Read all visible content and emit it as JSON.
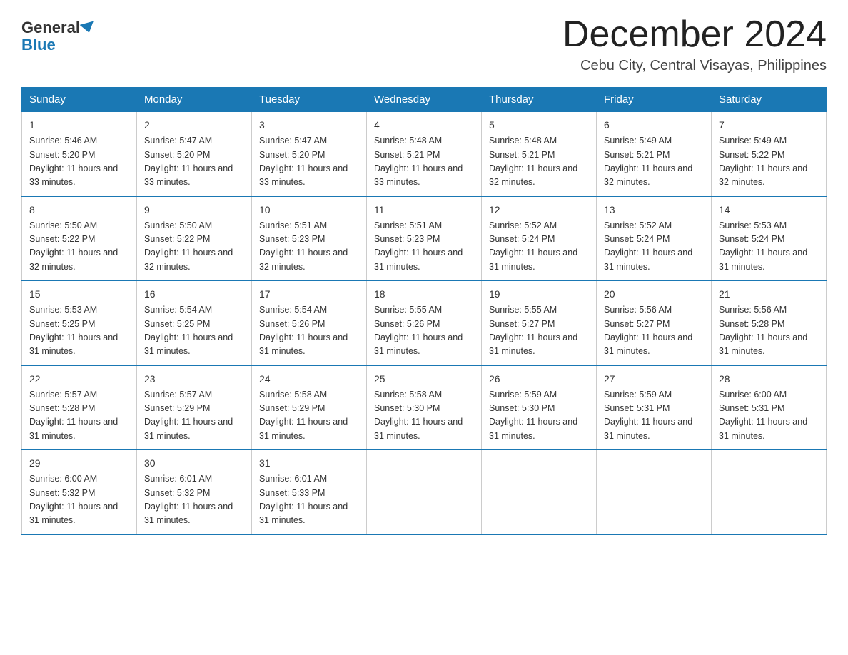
{
  "header": {
    "logo_general": "General",
    "logo_blue": "Blue",
    "month_title": "December 2024",
    "location": "Cebu City, Central Visayas, Philippines"
  },
  "weekdays": [
    "Sunday",
    "Monday",
    "Tuesday",
    "Wednesday",
    "Thursday",
    "Friday",
    "Saturday"
  ],
  "weeks": [
    [
      {
        "day": "1",
        "sunrise": "5:46 AM",
        "sunset": "5:20 PM",
        "daylight": "11 hours and 33 minutes."
      },
      {
        "day": "2",
        "sunrise": "5:47 AM",
        "sunset": "5:20 PM",
        "daylight": "11 hours and 33 minutes."
      },
      {
        "day": "3",
        "sunrise": "5:47 AM",
        "sunset": "5:20 PM",
        "daylight": "11 hours and 33 minutes."
      },
      {
        "day": "4",
        "sunrise": "5:48 AM",
        "sunset": "5:21 PM",
        "daylight": "11 hours and 33 minutes."
      },
      {
        "day": "5",
        "sunrise": "5:48 AM",
        "sunset": "5:21 PM",
        "daylight": "11 hours and 32 minutes."
      },
      {
        "day": "6",
        "sunrise": "5:49 AM",
        "sunset": "5:21 PM",
        "daylight": "11 hours and 32 minutes."
      },
      {
        "day": "7",
        "sunrise": "5:49 AM",
        "sunset": "5:22 PM",
        "daylight": "11 hours and 32 minutes."
      }
    ],
    [
      {
        "day": "8",
        "sunrise": "5:50 AM",
        "sunset": "5:22 PM",
        "daylight": "11 hours and 32 minutes."
      },
      {
        "day": "9",
        "sunrise": "5:50 AM",
        "sunset": "5:22 PM",
        "daylight": "11 hours and 32 minutes."
      },
      {
        "day": "10",
        "sunrise": "5:51 AM",
        "sunset": "5:23 PM",
        "daylight": "11 hours and 32 minutes."
      },
      {
        "day": "11",
        "sunrise": "5:51 AM",
        "sunset": "5:23 PM",
        "daylight": "11 hours and 31 minutes."
      },
      {
        "day": "12",
        "sunrise": "5:52 AM",
        "sunset": "5:24 PM",
        "daylight": "11 hours and 31 minutes."
      },
      {
        "day": "13",
        "sunrise": "5:52 AM",
        "sunset": "5:24 PM",
        "daylight": "11 hours and 31 minutes."
      },
      {
        "day": "14",
        "sunrise": "5:53 AM",
        "sunset": "5:24 PM",
        "daylight": "11 hours and 31 minutes."
      }
    ],
    [
      {
        "day": "15",
        "sunrise": "5:53 AM",
        "sunset": "5:25 PM",
        "daylight": "11 hours and 31 minutes."
      },
      {
        "day": "16",
        "sunrise": "5:54 AM",
        "sunset": "5:25 PM",
        "daylight": "11 hours and 31 minutes."
      },
      {
        "day": "17",
        "sunrise": "5:54 AM",
        "sunset": "5:26 PM",
        "daylight": "11 hours and 31 minutes."
      },
      {
        "day": "18",
        "sunrise": "5:55 AM",
        "sunset": "5:26 PM",
        "daylight": "11 hours and 31 minutes."
      },
      {
        "day": "19",
        "sunrise": "5:55 AM",
        "sunset": "5:27 PM",
        "daylight": "11 hours and 31 minutes."
      },
      {
        "day": "20",
        "sunrise": "5:56 AM",
        "sunset": "5:27 PM",
        "daylight": "11 hours and 31 minutes."
      },
      {
        "day": "21",
        "sunrise": "5:56 AM",
        "sunset": "5:28 PM",
        "daylight": "11 hours and 31 minutes."
      }
    ],
    [
      {
        "day": "22",
        "sunrise": "5:57 AM",
        "sunset": "5:28 PM",
        "daylight": "11 hours and 31 minutes."
      },
      {
        "day": "23",
        "sunrise": "5:57 AM",
        "sunset": "5:29 PM",
        "daylight": "11 hours and 31 minutes."
      },
      {
        "day": "24",
        "sunrise": "5:58 AM",
        "sunset": "5:29 PM",
        "daylight": "11 hours and 31 minutes."
      },
      {
        "day": "25",
        "sunrise": "5:58 AM",
        "sunset": "5:30 PM",
        "daylight": "11 hours and 31 minutes."
      },
      {
        "day": "26",
        "sunrise": "5:59 AM",
        "sunset": "5:30 PM",
        "daylight": "11 hours and 31 minutes."
      },
      {
        "day": "27",
        "sunrise": "5:59 AM",
        "sunset": "5:31 PM",
        "daylight": "11 hours and 31 minutes."
      },
      {
        "day": "28",
        "sunrise": "6:00 AM",
        "sunset": "5:31 PM",
        "daylight": "11 hours and 31 minutes."
      }
    ],
    [
      {
        "day": "29",
        "sunrise": "6:00 AM",
        "sunset": "5:32 PM",
        "daylight": "11 hours and 31 minutes."
      },
      {
        "day": "30",
        "sunrise": "6:01 AM",
        "sunset": "5:32 PM",
        "daylight": "11 hours and 31 minutes."
      },
      {
        "day": "31",
        "sunrise": "6:01 AM",
        "sunset": "5:33 PM",
        "daylight": "11 hours and 31 minutes."
      },
      null,
      null,
      null,
      null
    ]
  ]
}
